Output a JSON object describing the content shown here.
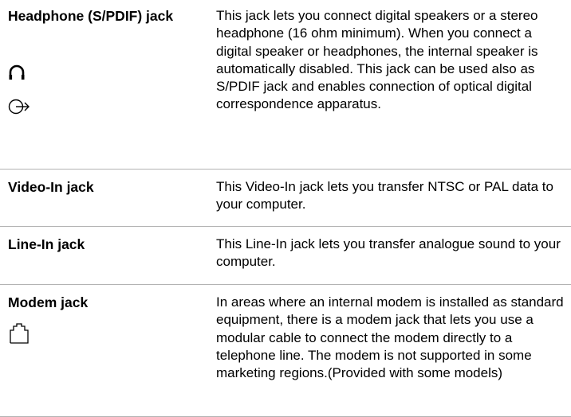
{
  "rows": [
    {
      "term": "Headphone (S/PDIF) jack",
      "description": "This jack lets you connect digital speakers or a stereo headphone (16 ohm minimum). When you connect a digital speaker or headphones, the internal speaker is automatically disabled. This jack can be used also as S/PDIF jack and enables connection of optical digital correspondence apparatus.",
      "icons": [
        "headphone-icon",
        "line-out-icon"
      ]
    },
    {
      "term": "Video-In jack",
      "description": "This Video-In jack lets you transfer NTSC or PAL data to your computer."
    },
    {
      "term": "Line-In jack",
      "description": "This Line-In jack lets you transfer analogue sound to your computer."
    },
    {
      "term": "Modem jack",
      "description": "In areas where an internal modem is installed as standard equipment, there is a modem jack that lets you use a modular cable to connect the modem directly to a telephone line. The modem is not supported in some marketing regions.(Provided with some models)",
      "icons": [
        "modem-jack-icon"
      ]
    }
  ],
  "colors": {
    "text": "#000000",
    "rule": "#b3b3b3"
  }
}
